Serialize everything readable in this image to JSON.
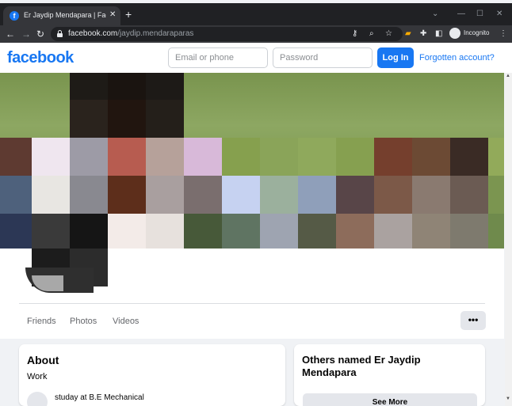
{
  "browser": {
    "tab_title": "Er Jaydip Mendapara | Facebook",
    "tab_close": "✕",
    "new_tab": "+",
    "url_host": "facebook.com",
    "url_path": "/jaydip.mendaraparas",
    "profile_label": "Incognito"
  },
  "header": {
    "logo": "facebook",
    "email_placeholder": "Email or phone",
    "password_placeholder": "Password",
    "login_label": "Log In",
    "forgot_label": "Forgotten account?"
  },
  "profile_nav": {
    "items": [
      "Friends",
      "Photos",
      "Videos"
    ],
    "more_label": "•••"
  },
  "about": {
    "title": "About",
    "section": "Work",
    "study_prefix": "studay at ",
    "study_school": "B.E Mechanical"
  },
  "others": {
    "title": "Others named Er Jaydip Mendapara",
    "see_more": "See More"
  },
  "colors": {
    "brand": "#1877f2",
    "page_bg": "#f0f2f5",
    "chrome_dark": "#202124",
    "chrome_bar": "#35363a"
  }
}
